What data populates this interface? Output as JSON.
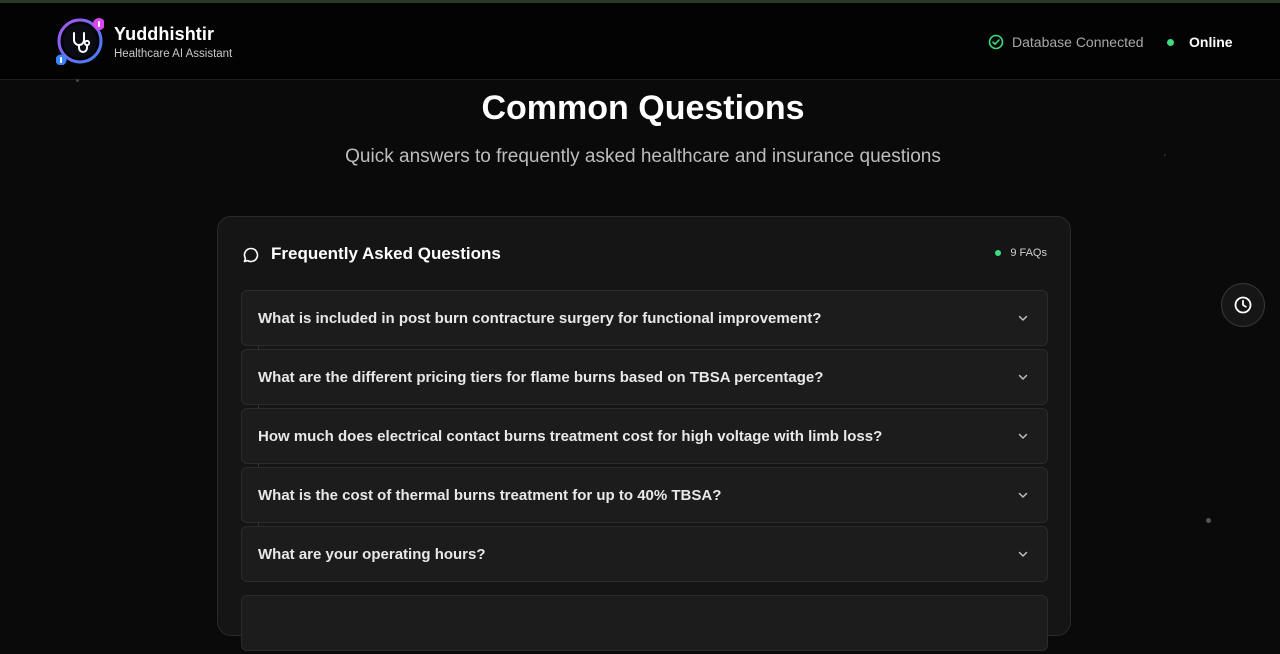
{
  "app": {
    "name": "Yuddhishtir",
    "subtitle": "Healthcare AI Assistant"
  },
  "status": {
    "database": "Database Connected",
    "connection": "Online"
  },
  "page": {
    "title": "Common Questions",
    "subtitle": "Quick answers to frequently asked healthcare and insurance questions"
  },
  "faq": {
    "title": "Frequently Asked Questions",
    "count_label": "9 FAQs",
    "items": [
      {
        "question": "What is included in post burn contracture surgery for functional improvement?"
      },
      {
        "question": "What are the different pricing tiers for flame burns based on TBSA percentage?"
      },
      {
        "question": "How much does electrical contact burns treatment cost for high voltage with limb loss?"
      },
      {
        "question": "What is the cost of thermal burns treatment for up to 40% TBSA?"
      },
      {
        "question": "What are your operating hours?"
      }
    ]
  },
  "colors": {
    "accent_green": "#3ddc84",
    "logo_purple": "#8b5cf6",
    "logo_blue": "#3b82f6",
    "logo_pink": "#d946ef"
  },
  "icons": {
    "logo": "stethoscope-icon",
    "database_status": "check-circle-icon",
    "faq_header": "chat-bubble-icon",
    "faq_toggle": "chevron-down-icon",
    "history": "clock-icon"
  }
}
